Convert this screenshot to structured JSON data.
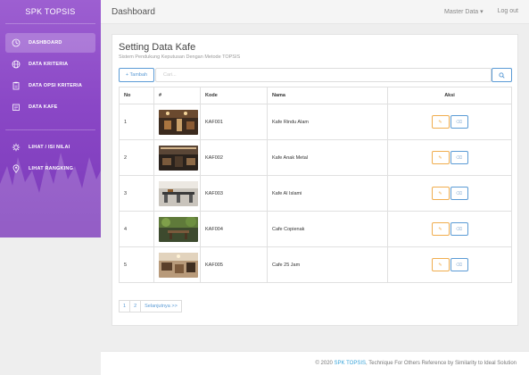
{
  "brand": "SPK TOPSIS",
  "sidebar": {
    "items": [
      {
        "label": "DASHBOARD",
        "icon": "dashboard-icon",
        "active": true
      },
      {
        "label": "DATA KRITERIA",
        "icon": "globe-icon",
        "active": false
      },
      {
        "label": "DATA OPSI KRITERIA",
        "icon": "clipboard-icon",
        "active": false
      },
      {
        "label": "DATA KAFE",
        "icon": "document-icon",
        "active": false
      },
      {
        "label": "LIHAT / ISI NILAI",
        "icon": "gear-icon",
        "active": false
      },
      {
        "label": "LIHAT RANGKING",
        "icon": "location-pin-icon",
        "active": false
      }
    ]
  },
  "topbar": {
    "title": "Dashboard",
    "master_data": "Master Data ▾",
    "logout": "Log out"
  },
  "card": {
    "title": "Setting Data Kafe",
    "subtitle": "Sistem Pendukung Keputusan Dengan Metode TOPSIS",
    "add_label": "+ Tambah",
    "search_placeholder": "Cari..."
  },
  "table": {
    "headers": [
      "No",
      "#",
      "Kode",
      "Nama",
      "Aksi"
    ],
    "rows": [
      {
        "no": "1",
        "kode": "KAF001",
        "nama": "Kafe Rindu Alam"
      },
      {
        "no": "2",
        "kode": "KAF002",
        "nama": "Kafe Anak Metal"
      },
      {
        "no": "3",
        "kode": "KAF003",
        "nama": "Kafe Al Islami"
      },
      {
        "no": "4",
        "kode": "KAF004",
        "nama": "Cafe Copienak"
      },
      {
        "no": "5",
        "kode": "KAF005",
        "nama": "Cafe 25 Jam"
      }
    ]
  },
  "pagination": [
    "1",
    "2",
    "Selanjutnya >>"
  ],
  "footer": {
    "prefix": "© 2020 ",
    "link": "SPK TOPSIS",
    "suffix": ", Technique For Others Reference by Similarity to Ideal Solution"
  },
  "colors": {
    "sidebar_top": "#9d5fd1",
    "sidebar_bottom": "#7b3ab9",
    "primary": "#5b9bd5",
    "warning": "#f0ad4e",
    "footer_link": "#36a3d9"
  }
}
